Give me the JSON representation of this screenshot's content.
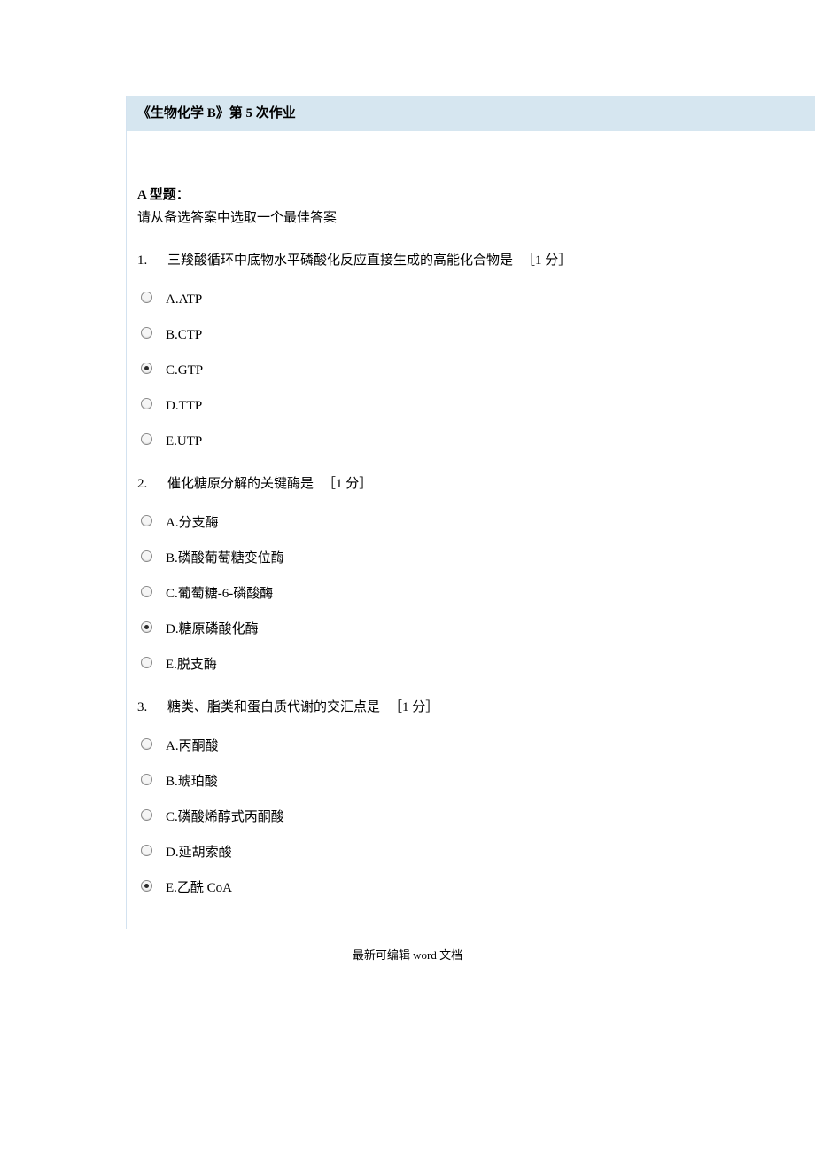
{
  "header": {
    "title": "《生物化学 B》第 5 次作业"
  },
  "section": {
    "title": "A 型题：",
    "subtitle": "请从备选答案中选取一个最佳答案"
  },
  "questions": [
    {
      "number": "1.",
      "text": "三羧酸循环中底物水平磷酸化反应直接生成的高能化合物是",
      "points": "［1 分］",
      "options": [
        {
          "key": "A",
          "label": "A.ATP",
          "selected": false
        },
        {
          "key": "B",
          "label": "B.CTP",
          "selected": false
        },
        {
          "key": "C",
          "label": "C.GTP",
          "selected": true
        },
        {
          "key": "D",
          "label": "D.TTP",
          "selected": false
        },
        {
          "key": "E",
          "label": "E.UTP",
          "selected": false
        }
      ]
    },
    {
      "number": "2.",
      "text": "催化糖原分解的关键酶是",
      "points": "［1 分］",
      "options": [
        {
          "key": "A",
          "label": "A.分支酶",
          "selected": false
        },
        {
          "key": "B",
          "label": "B.磷酸葡萄糖变位酶",
          "selected": false
        },
        {
          "key": "C",
          "label": "C.葡萄糖-6-磷酸酶",
          "selected": false
        },
        {
          "key": "D",
          "label": "D.糖原磷酸化酶",
          "selected": true
        },
        {
          "key": "E",
          "label": "E.脱支酶",
          "selected": false
        }
      ]
    },
    {
      "number": "3.",
      "text": "糖类、脂类和蛋白质代谢的交汇点是",
      "points": "［1 分］",
      "options": [
        {
          "key": "A",
          "label": "A.丙酮酸",
          "selected": false
        },
        {
          "key": "B",
          "label": "B.琥珀酸",
          "selected": false
        },
        {
          "key": "C",
          "label": "C.磷酸烯醇式丙酮酸",
          "selected": false
        },
        {
          "key": "D",
          "label": "D.延胡索酸",
          "selected": false
        },
        {
          "key": "E",
          "label": "E.乙酰 CoA",
          "selected": true
        }
      ]
    }
  ],
  "footer": {
    "prefix": "最新可编辑 ",
    "word": "word",
    "suffix": " 文档"
  }
}
